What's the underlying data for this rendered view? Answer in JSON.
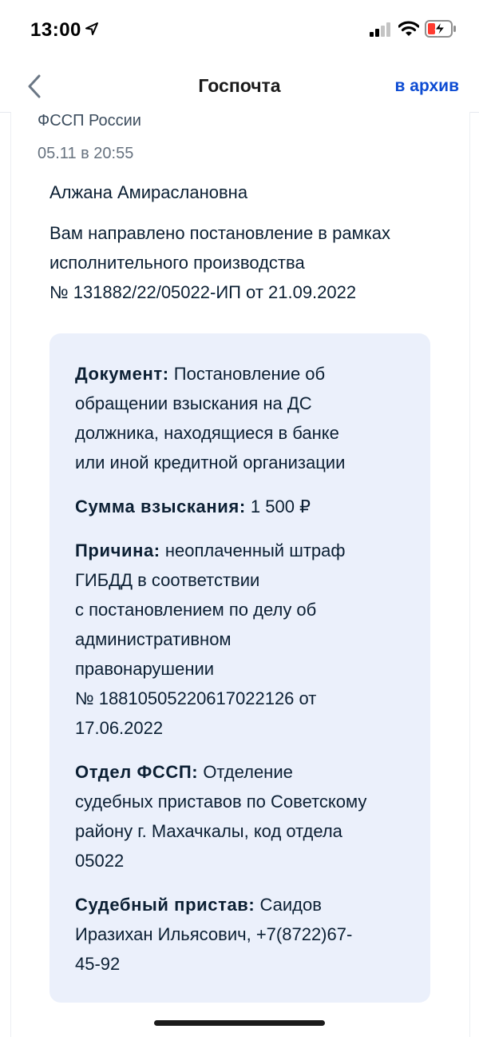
{
  "status_bar": {
    "time": "13:00",
    "icons": [
      "location-arrow-icon",
      "signal-icon",
      "wifi-icon",
      "battery-charging-icon"
    ]
  },
  "nav": {
    "back_icon": "chevron-left-icon",
    "title": "Госпочта",
    "archive_label": "в архив"
  },
  "message": {
    "sender": "ФССП России",
    "date": "05.11 в 20:55",
    "recipient": "Алжана Амираслановна",
    "intro_lines": [
      "Вам направлено постановление в рамках",
      "исполнительного производства",
      "№ 131882/22/05022-ИП от 21.09.2022"
    ],
    "details": {
      "document": {
        "label": "Документ:",
        "first_line": "Постановление об",
        "lines": [
          "обращении взыскания на ДС",
          "должника, находящиеся в банке",
          "или иной кредитной организации"
        ]
      },
      "amount": {
        "label": "Сумма взыскания:",
        "value": "1 500 ₽"
      },
      "reason": {
        "label": "Причина:",
        "first_line": "неоплаченный штраф",
        "lines": [
          "ГИБДД в соответствии",
          "с постановлением по делу об",
          "административном",
          "правонарушении",
          "№ 18810505220617022126 от",
          "17.06.2022"
        ]
      },
      "department": {
        "label": "Отдел ФССП:",
        "first_line": "Отделение",
        "lines": [
          "судебных приставов по Советскому",
          "району г. Махачкалы, код отдела",
          "05022"
        ]
      },
      "bailiff": {
        "label": "Судебный пристав:",
        "first_line": "Саидов",
        "lines": [
          "Иразихан Ильясович, +7(8722)67-",
          "45-92"
        ]
      }
    }
  },
  "colors": {
    "accent": "#0d4cd3",
    "text": "#0b1f33",
    "muted": "#66727f",
    "details_bg": "#ebf0fb"
  }
}
